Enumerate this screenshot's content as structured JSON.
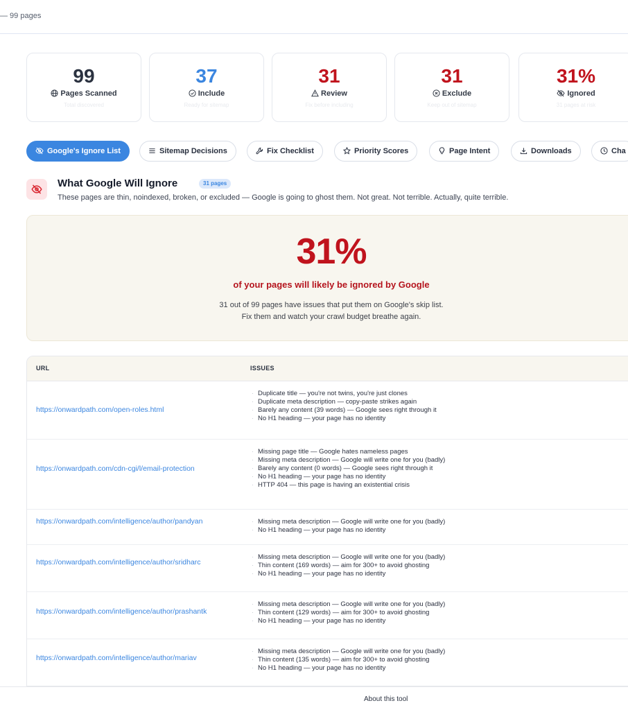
{
  "topbar": {
    "text": "— 99 pages"
  },
  "stats": [
    {
      "value": "99",
      "label": "Pages Scanned",
      "sub": "Total discovered",
      "icon": "globe-icon",
      "color": "#2b3240"
    },
    {
      "value": "37",
      "label": "Include",
      "sub": "Ready for sitemap",
      "icon": "check-circle-icon",
      "color": "#3b86e0"
    },
    {
      "value": "31",
      "label": "Review",
      "sub": "Fix before including",
      "icon": "warning-icon",
      "color": "#c0131d"
    },
    {
      "value": "31",
      "label": "Exclude",
      "sub": "Keep out of sitemap",
      "icon": "x-circle-icon",
      "color": "#c0131d"
    },
    {
      "value": "31%",
      "label": "Ignored",
      "sub": "31 pages at risk",
      "icon": "eye-off-icon",
      "color": "#c0131d"
    }
  ],
  "tabs": [
    {
      "label": "Google's Ignore List",
      "icon": "eye-off-icon",
      "active": true
    },
    {
      "label": "Sitemap Decisions",
      "icon": "list-icon",
      "active": false
    },
    {
      "label": "Fix Checklist",
      "icon": "wrench-icon",
      "active": false
    },
    {
      "label": "Priority Scores",
      "icon": "star-icon",
      "active": false
    },
    {
      "label": "Page Intent",
      "icon": "lightbulb-icon",
      "active": false
    },
    {
      "label": "Downloads",
      "icon": "download-icon",
      "active": false
    },
    {
      "label": "Cha",
      "icon": "clock-icon",
      "active": false
    }
  ],
  "section": {
    "title": "What Google Will Ignore",
    "badge": "31 pages",
    "description": "These pages are thin, noindexed, broken, or excluded — Google is going to ghost them. Not great. Not terrible. Actually, quite terrible."
  },
  "hero": {
    "percent": "31%",
    "headline": "of your pages will likely be ignored by Google",
    "line1": "31 out of 99 pages have issues that put them on Google's skip list.",
    "line2": "Fix them and watch your crawl budget breathe again."
  },
  "table": {
    "headers": {
      "url": "URL",
      "issues": "ISSUES"
    },
    "rows": [
      {
        "url": "https://onwardpath.com/open-roles.html",
        "issues": [
          "Duplicate title — you're not twins, you're just clones",
          "Duplicate meta description — copy-paste strikes again",
          "Barely any content (39 words) — Google sees right through it",
          "No H1 heading — your page has no identity"
        ]
      },
      {
        "url": "https://onwardpath.com/cdn-cgi/l/email-protection",
        "issues": [
          "Missing page title — Google hates nameless pages",
          "Missing meta description — Google will write one for you (badly)",
          "Barely any content (0 words) — Google sees right through it",
          "No H1 heading — your page has no identity",
          "HTTP 404 — this page is having an existential crisis"
        ]
      },
      {
        "url": "https://onwardpath.com/intelligence/author/pandyan",
        "issues": [
          "Missing meta description — Google will write one for you (badly)",
          "No H1 heading — your page has no identity"
        ]
      },
      {
        "url": "https://onwardpath.com/intelligence/author/sridharc",
        "issues": [
          "Missing meta description — Google will write one for you (badly)",
          "Thin content (169 words) — aim for 300+ to avoid ghosting",
          "No H1 heading — your page has no identity"
        ]
      },
      {
        "url": "https://onwardpath.com/intelligence/author/prashantk",
        "issues": [
          "Missing meta description — Google will write one for you (badly)",
          "Thin content (129 words) — aim for 300+ to avoid ghosting",
          "No H1 heading — your page has no identity"
        ]
      },
      {
        "url": "https://onwardpath.com/intelligence/author/mariav",
        "issues": [
          "Missing meta description — Google will write one for you (badly)",
          "Thin content (135 words) — aim for 300+ to avoid ghosting",
          "No H1 heading — your page has no identity"
        ]
      }
    ]
  },
  "footer": {
    "link": "About this tool"
  }
}
